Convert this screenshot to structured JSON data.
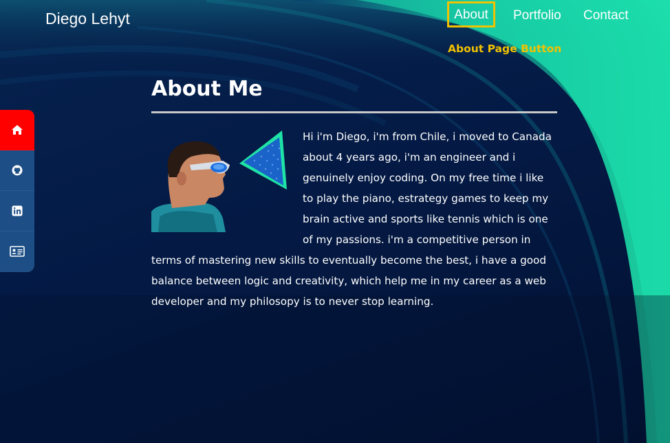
{
  "header": {
    "brand": "Diego Lehyt",
    "nav": [
      {
        "label": "About"
      },
      {
        "label": "Portfolio"
      },
      {
        "label": "Contact"
      }
    ],
    "annotation": "About Page Button",
    "highlight_color": "#f2c200"
  },
  "sidebar": {
    "items": [
      {
        "icon": "home-icon",
        "active": true
      },
      {
        "icon": "github-icon",
        "active": false
      },
      {
        "icon": "linkedin-icon",
        "active": false
      },
      {
        "icon": "id-card-icon",
        "active": false
      }
    ],
    "active_color": "#ff0000",
    "bg_color": "#1d4f86"
  },
  "main": {
    "title": "About Me",
    "bio": "Hi i'm Diego, i'm from Chile, i moved to Canada about 4 years ago, i'm an engineer and i genuinely enjoy coding. On my free time i like to play the piano, estrategy games to keep my brain active and sports like tennis which is one of my passions. i'm a competitive person in terms of mastering new skills to eventually become the best, i have a good balance between logic and creativity, which help me in my career as a web developer and my philosopy is to never stop learning."
  },
  "colors": {
    "background": "#041a45",
    "accent_teal": "#19e0a8"
  }
}
